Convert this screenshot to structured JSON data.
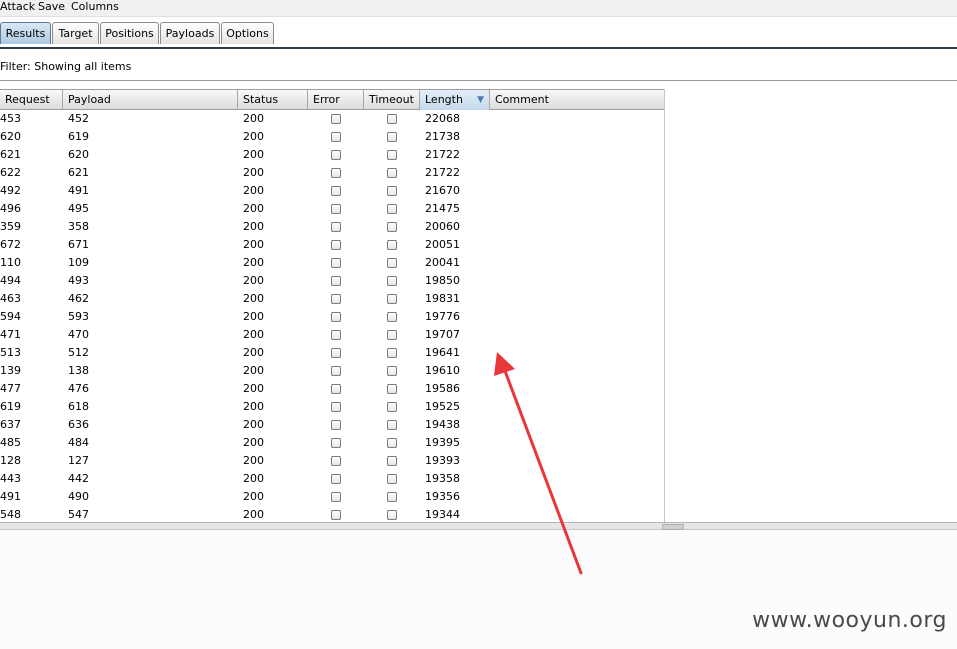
{
  "menu": [
    "Attack",
    "Save",
    "Columns"
  ],
  "tabs": [
    {
      "label": "Results",
      "active": true
    },
    {
      "label": "Target",
      "active": false
    },
    {
      "label": "Positions",
      "active": false
    },
    {
      "label": "Payloads",
      "active": false
    },
    {
      "label": "Options",
      "active": false
    }
  ],
  "filter": "Filter:  Showing all items",
  "table": {
    "columns": [
      "Request",
      "Payload",
      "Status",
      "Error",
      "Timeout",
      "Length",
      "Comment"
    ],
    "sorted_column": "Length",
    "sort_direction": "descending",
    "rows": [
      {
        "request": "453",
        "payload": "452",
        "status": "200",
        "length": "22068"
      },
      {
        "request": "620",
        "payload": "619",
        "status": "200",
        "length": "21738"
      },
      {
        "request": "621",
        "payload": "620",
        "status": "200",
        "length": "21722"
      },
      {
        "request": "622",
        "payload": "621",
        "status": "200",
        "length": "21722"
      },
      {
        "request": "492",
        "payload": "491",
        "status": "200",
        "length": "21670"
      },
      {
        "request": "496",
        "payload": "495",
        "status": "200",
        "length": "21475"
      },
      {
        "request": "359",
        "payload": "358",
        "status": "200",
        "length": "20060"
      },
      {
        "request": "672",
        "payload": "671",
        "status": "200",
        "length": "20051"
      },
      {
        "request": "110",
        "payload": "109",
        "status": "200",
        "length": "20041"
      },
      {
        "request": "494",
        "payload": "493",
        "status": "200",
        "length": "19850"
      },
      {
        "request": "463",
        "payload": "462",
        "status": "200",
        "length": "19831"
      },
      {
        "request": "594",
        "payload": "593",
        "status": "200",
        "length": "19776"
      },
      {
        "request": "471",
        "payload": "470",
        "status": "200",
        "length": "19707"
      },
      {
        "request": "513",
        "payload": "512",
        "status": "200",
        "length": "19641"
      },
      {
        "request": "139",
        "payload": "138",
        "status": "200",
        "length": "19610"
      },
      {
        "request": "477",
        "payload": "476",
        "status": "200",
        "length": "19586"
      },
      {
        "request": "619",
        "payload": "618",
        "status": "200",
        "length": "19525"
      },
      {
        "request": "637",
        "payload": "636",
        "status": "200",
        "length": "19438"
      },
      {
        "request": "485",
        "payload": "484",
        "status": "200",
        "length": "19395"
      },
      {
        "request": "128",
        "payload": "127",
        "status": "200",
        "length": "19393"
      },
      {
        "request": "443",
        "payload": "442",
        "status": "200",
        "length": "19358"
      },
      {
        "request": "491",
        "payload": "490",
        "status": "200",
        "length": "19356"
      },
      {
        "request": "548",
        "payload": "547",
        "status": "200",
        "length": "19344"
      }
    ]
  },
  "watermark": "www.wooyun.org",
  "colors": {
    "annotation_arrow": "#e8363a",
    "active_tab": "#aec9e2"
  }
}
